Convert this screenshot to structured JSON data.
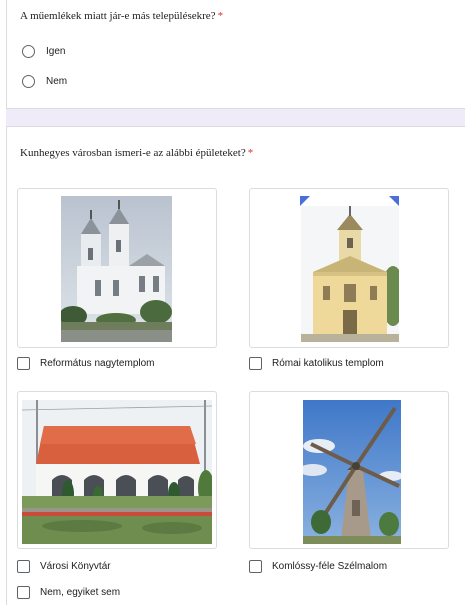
{
  "question1": {
    "title": "A műemlékek miatt jár-e más településekre?",
    "required_mark": "*",
    "options": [
      "Igen",
      "Nem"
    ]
  },
  "question2": {
    "title": "Kunhegyes városban ismeri-e az alábbi épületeket?",
    "required_mark": "*",
    "options": [
      {
        "label": "Református nagytemplom",
        "image": "twin-tower-church-photo"
      },
      {
        "label": "Római katolikus templom",
        "image": "catholic-church-photo"
      },
      {
        "label": "Városi Könyvtár",
        "image": "library-building-photo"
      },
      {
        "label": "Komlóssy-féle Szélmalom",
        "image": "windmill-photo"
      }
    ],
    "none_option": "Nem, egyiket sem"
  },
  "colors": {
    "required": "#d93025",
    "border": "#dadce0",
    "section_gap": "#f0ebf8",
    "accent_corner": "#4a6fd8"
  }
}
